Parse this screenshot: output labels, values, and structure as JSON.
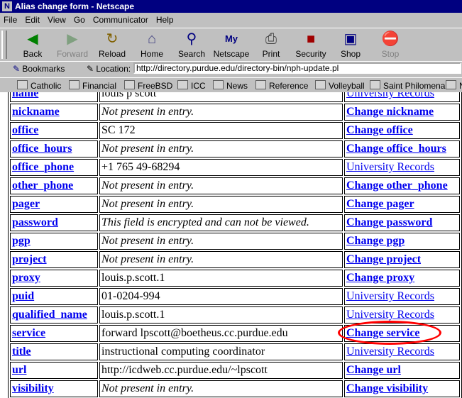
{
  "window": {
    "title": "Alias change form - Netscape"
  },
  "menu": [
    "File",
    "Edit",
    "View",
    "Go",
    "Communicator",
    "Help"
  ],
  "toolbar": [
    {
      "label": "Back",
      "icon": "back-arrow-icon",
      "enabled": true
    },
    {
      "label": "Forward",
      "icon": "forward-arrow-icon",
      "enabled": false
    },
    {
      "label": "Reload",
      "icon": "reload-icon",
      "enabled": true
    },
    {
      "label": "Home",
      "icon": "home-icon",
      "enabled": true
    },
    {
      "label": "Search",
      "icon": "search-icon",
      "enabled": true
    },
    {
      "label": "Netscape",
      "icon": "netscape-icon",
      "enabled": true
    },
    {
      "label": "Print",
      "icon": "print-icon",
      "enabled": true
    },
    {
      "label": "Security",
      "icon": "lock-icon",
      "enabled": true
    },
    {
      "label": "Shop",
      "icon": "shop-icon",
      "enabled": true
    },
    {
      "label": "Stop",
      "icon": "stop-icon",
      "enabled": false
    }
  ],
  "location": {
    "bookmarks_label": "Bookmarks",
    "label": "Location:",
    "url": "http://directory.purdue.edu/directory-bin/nph-update.pl"
  },
  "personal": [
    "Catholic",
    "Financial",
    "FreeBSD",
    "ICC",
    "News",
    "Reference",
    "Volleyball",
    "Saint Philomena",
    "N"
  ],
  "rows": [
    {
      "field": "name",
      "value": "louis p scott",
      "italic": false,
      "action": "University Records",
      "bold": false
    },
    {
      "field": "nickname",
      "value": "Not present in entry.",
      "italic": true,
      "action": "Change nickname",
      "bold": true
    },
    {
      "field": "office",
      "value": "SC 172",
      "italic": false,
      "action": "Change office",
      "bold": true
    },
    {
      "field": "office_hours",
      "value": "Not present in entry.",
      "italic": true,
      "action": "Change office_hours",
      "bold": true
    },
    {
      "field": "office_phone",
      "value": "+1 765 49-68294",
      "italic": false,
      "action": "University Records",
      "bold": false
    },
    {
      "field": "other_phone",
      "value": "Not present in entry.",
      "italic": true,
      "action": "Change other_phone",
      "bold": true
    },
    {
      "field": "pager",
      "value": "Not present in entry.",
      "italic": true,
      "action": "Change pager",
      "bold": true
    },
    {
      "field": "password",
      "value": "This field is encrypted and can not be viewed.",
      "italic": true,
      "action": "Change password",
      "bold": true
    },
    {
      "field": "pgp",
      "value": "Not present in entry.",
      "italic": true,
      "action": "Change pgp",
      "bold": true
    },
    {
      "field": "project",
      "value": "Not present in entry.",
      "italic": true,
      "action": "Change project",
      "bold": true
    },
    {
      "field": "proxy",
      "value": "louis.p.scott.1",
      "italic": false,
      "action": "Change proxy",
      "bold": true
    },
    {
      "field": "puid",
      "value": "01-0204-994",
      "italic": false,
      "action": "University Records",
      "bold": false
    },
    {
      "field": "qualified_name",
      "value": "louis.p.scott.1",
      "italic": false,
      "action": "University Records",
      "bold": false
    },
    {
      "field": "service",
      "value": "forward lpscott@boetheus.cc.purdue.edu",
      "italic": false,
      "action": "Change service",
      "bold": true
    },
    {
      "field": "title",
      "value": "instructional computing coordinator",
      "italic": false,
      "action": "University Records",
      "bold": false
    },
    {
      "field": "url",
      "value": "http://icdweb.cc.purdue.edu/~lpscott",
      "italic": false,
      "action": "Change url",
      "bold": true
    },
    {
      "field": "visibility",
      "value": "Not present in entry.",
      "italic": true,
      "action": "Change visibility",
      "bold": true
    }
  ],
  "colors": {
    "title_bg": "#000080",
    "link": "#0000ee",
    "highlight_circle": "#ff0000"
  }
}
